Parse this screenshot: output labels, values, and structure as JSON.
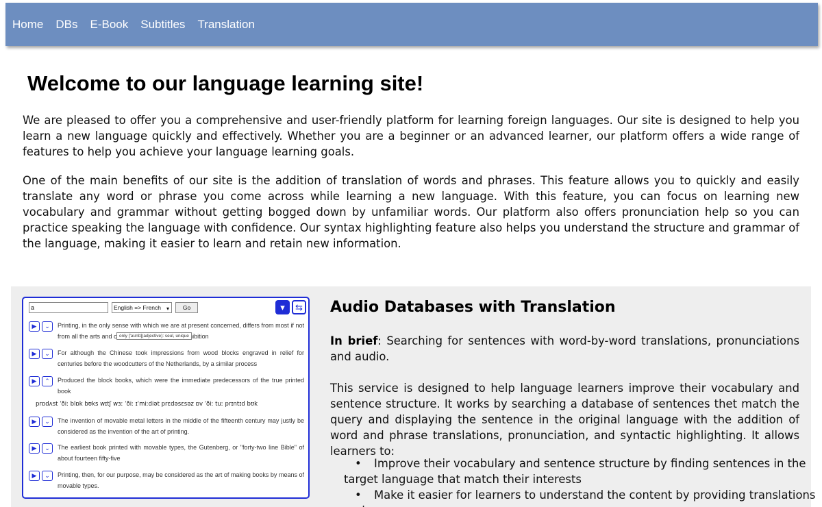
{
  "nav": {
    "items": [
      "Home",
      "DBs",
      "E-Book",
      "Subtitles",
      "Translation"
    ]
  },
  "welcome": {
    "title": "Welcome to our language learning site!",
    "p1": "We are pleased to offer you a comprehensive and user-friendly platform for learning foreign languages. Our site is designed to help you learn a new language quickly and effectively. Whether you are a beginner or an advanced learner, our platform offers a wide range of features to help you achieve your language learning goals.",
    "p2": "One of the main benefits of our site is the addition of translation of words and phrases. This feature allows you to quickly and easily translate any word or phrase you come across while learning a new language. With this feature, you can focus on learning new vocabulary and grammar without getting bogged down by unfamiliar words. Our platform also offers pronunciation help so you can practice speaking the language with confidence. Our syntax highlighting feature also helps you understand the structure and grammar of the language, making it easier to learn and retain new information."
  },
  "demo": {
    "query": "a",
    "language": "English => French",
    "go_label": "Go",
    "tooltip": "only ['əʊnlɪ](adjective): seul, unique",
    "pronunciation": "prɒdʌst ˈðiː blɒk bʊks wɪtʃ wɜː ˈðiː ɪˈmiːdiət prɛdəsɛsəz ɒv ˈðiː tuː prɪntɪd bʊk",
    "rows": [
      {
        "text": "Printing, in the only sense with which we are at present concerned, differs from most if not from all the arts and crafts represented in the Exhibition"
      },
      {
        "text": "For although the Chinese took impressions from wood blocks engraved in relief for centuries before the woodcutters of the Netherlands, by a similar process"
      },
      {
        "text": "Produced the block books, which were the immediate predecessors of the true printed book"
      },
      {
        "text": "The invention of movable metal letters in the middle of the fifteenth century may justly be considered as the invention of the art of printing."
      },
      {
        "text": "The earliest book printed with movable types, the Gutenberg, or \"forty-two line Bible\" of about fourteen fifty-five"
      },
      {
        "text": "Printing, then, for our purpose, may be considered as the art of making books by means of movable types."
      }
    ]
  },
  "feature": {
    "title": "Audio Databases with Translation",
    "brief_label": "In brief",
    "brief_text": ": Searching for sentences with word-by-word translations, pronunciations and audio.",
    "desc": "This service is designed to help language learners improve their vocabulary and sentence structure. It works by searching a database of sentences thet match the query and displaying the sentence in the original language with the addition of word and phrase translations, pronunciation, and syntactic highlighting. It allows learners to:",
    "list": [
      "Improve their vocabulary and sentence structure by finding sentences in the target language that match their interests",
      "Make it easier for learners to understand the content by providing translations and"
    ]
  }
}
